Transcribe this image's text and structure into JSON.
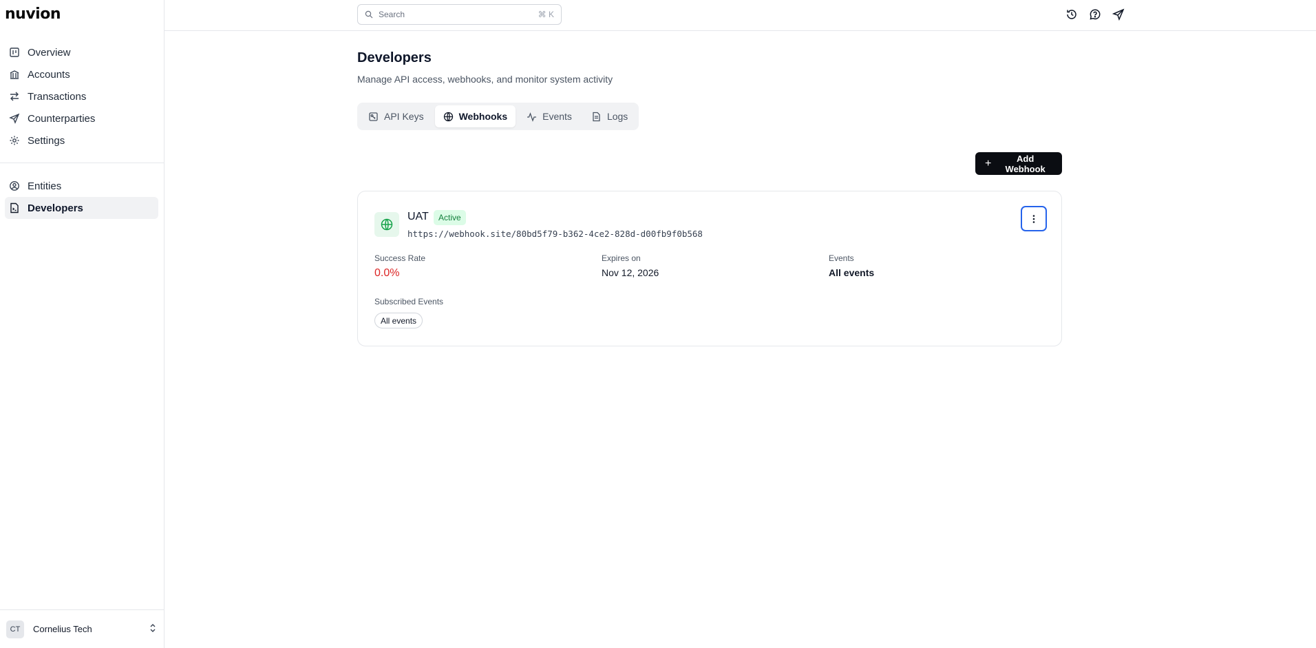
{
  "brand": {
    "logo_text": "nuvion"
  },
  "sidebar": {
    "primary": [
      {
        "label": "Overview",
        "icon": "overview-icon"
      },
      {
        "label": "Accounts",
        "icon": "bank-icon"
      },
      {
        "label": "Transactions",
        "icon": "arrows-left-right-icon"
      },
      {
        "label": "Counterparties",
        "icon": "send-icon"
      },
      {
        "label": "Settings",
        "icon": "gear-icon"
      }
    ],
    "secondary": [
      {
        "label": "Entities",
        "icon": "user-circle-icon"
      },
      {
        "label": "Developers",
        "icon": "file-terminal-icon",
        "active": true
      }
    ],
    "user": {
      "initials": "CT",
      "name": "Cornelius Tech"
    }
  },
  "topbar": {
    "search_placeholder": "Search",
    "search_shortcut": "⌘ K",
    "icons": [
      "history-icon",
      "help-chat-icon",
      "send-icon"
    ]
  },
  "page": {
    "title": "Developers",
    "subtitle": "Manage API access, webhooks, and monitor system activity",
    "tabs": [
      {
        "label": "API Keys",
        "icon": "key-icon"
      },
      {
        "label": "Webhooks",
        "icon": "globe-icon",
        "active": true
      },
      {
        "label": "Events",
        "icon": "activity-icon"
      },
      {
        "label": "Logs",
        "icon": "file-icon"
      }
    ],
    "add_button_label": "Add Webhook"
  },
  "webhook": {
    "name": "UAT",
    "status": "Active",
    "url": "https://webhook.site/80bd5f79-b362-4ce2-828d-d00fb9f0b568",
    "success_rate_label": "Success Rate",
    "success_rate_value": "0.0%",
    "expires_label": "Expires on",
    "expires_value": "Nov 12, 2026",
    "events_label": "Events",
    "events_value": "All events",
    "subscribed_label": "Subscribed Events",
    "subscribed_events": [
      "All events"
    ]
  },
  "colors": {
    "accent_dark": "#0b0d12",
    "status_green": "#15803d",
    "rate_red": "#dc2626",
    "focus_blue": "#2563eb"
  }
}
